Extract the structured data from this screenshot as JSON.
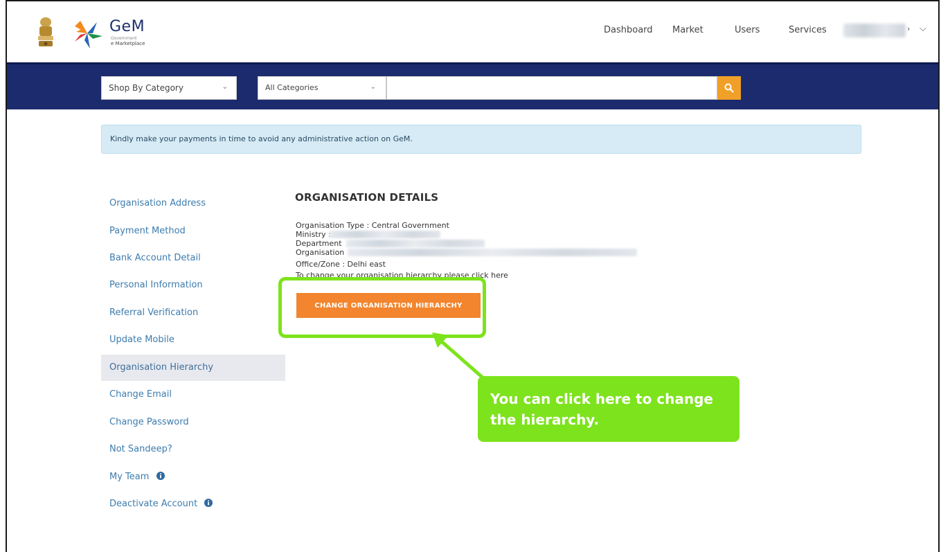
{
  "header": {
    "logo_title": "GeM",
    "logo_sub_top": "Government",
    "logo_sub_bottom": "e Marketplace",
    "nav": [
      "Dashboard",
      "Market",
      "Users",
      "Services"
    ]
  },
  "search": {
    "shop_by_category": "Shop By Category",
    "all_categories": "All Categories",
    "placeholder": ""
  },
  "notice": {
    "text": "Kindly make your payments in time to avoid any administrative action on GeM."
  },
  "sidebar": {
    "items": [
      {
        "label": "Organisation Address"
      },
      {
        "label": "Payment Method"
      },
      {
        "label": "Bank Account Detail"
      },
      {
        "label": "Personal Information"
      },
      {
        "label": "Referral Verification"
      },
      {
        "label": "Update Mobile"
      },
      {
        "label": "Organisation Hierarchy"
      },
      {
        "label": "Change Email"
      },
      {
        "label": "Change Password"
      },
      {
        "label": "Not Sandeep?"
      },
      {
        "label": "My Team"
      },
      {
        "label": "Deactivate Account"
      }
    ],
    "active_item": "Organisation Hierarchy"
  },
  "main": {
    "heading": "ORGANISATION DETAILS",
    "org_type": "Organisation Type : Central Government",
    "ministry": "Ministry : ",
    "department": "Department",
    "organisation": "Organisation",
    "office_zone": "Office/Zone : Delhi east",
    "change_text": "To change your organisation hierarchy please click here",
    "change_button": "CHANGE ORGANISATION HIERARCHY"
  },
  "callout": {
    "text": "You can click here to change the hierarchy."
  },
  "colors": {
    "brand_navy": "#1c2b6e",
    "search_orange": "#f0a028",
    "button_orange": "#f2852d",
    "highlight_green": "#7de31c",
    "link_blue": "#3d7cae",
    "notice_blue": "#d6ebf5"
  }
}
